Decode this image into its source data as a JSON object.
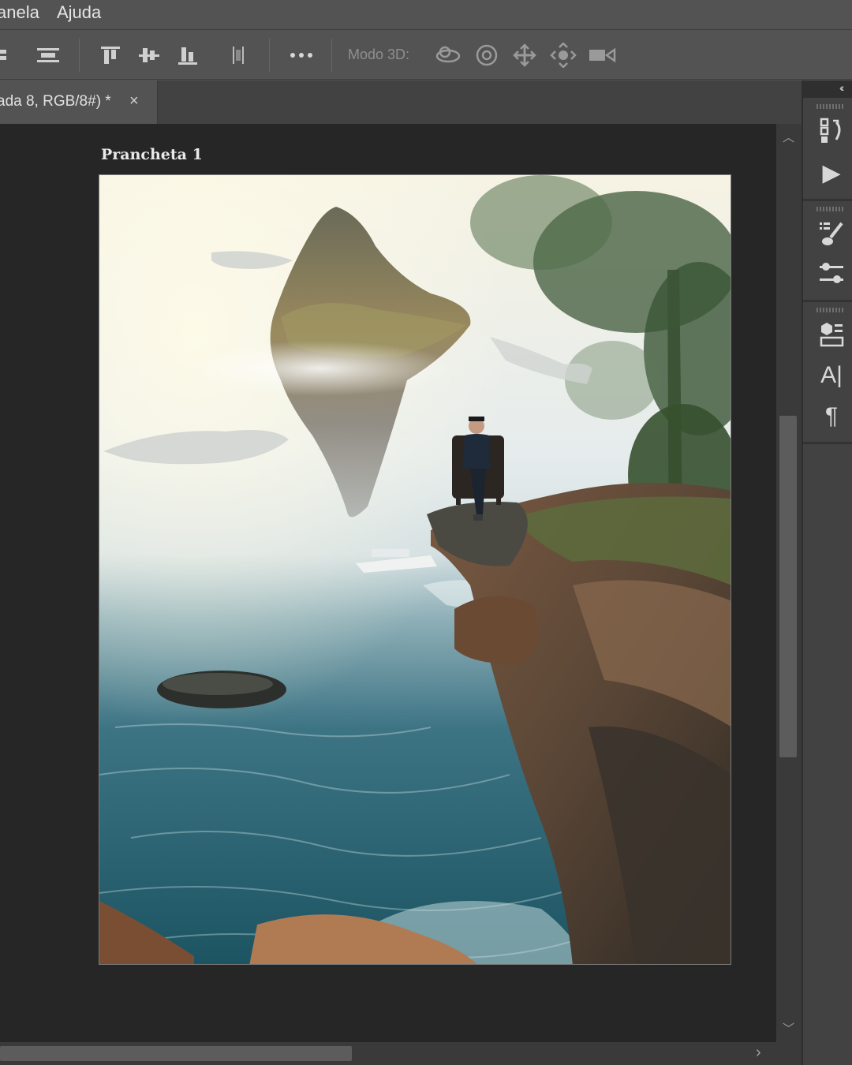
{
  "menu": {
    "items": [
      "anela",
      "Ajuda"
    ]
  },
  "options_bar": {
    "mode3d_label": "Modo 3D:",
    "icons": [
      "align-left-edge-icon",
      "align-center-horizontal-icon",
      "align-top-edge-icon",
      "align-vertical-center-icon",
      "align-bottom-edge-icon",
      "distribute-icon",
      "more-options-icon",
      "orbit-3d-icon",
      "roll-3d-icon",
      "pan-3d-icon",
      "slide-3d-icon",
      "scale-3d-icon"
    ]
  },
  "tab": {
    "title": "ada 8, RGB/8#) *",
    "close_glyph": "×"
  },
  "artboard": {
    "label": "Prancheta 1"
  },
  "scrollbars": {
    "up_glyph": "︿",
    "down_glyph": "﹀",
    "right_glyph": "›"
  },
  "dock": {
    "collapse_glyph": "‹‹",
    "icons": [
      "history-icon",
      "actions-play-icon",
      "brush-settings-icon",
      "adjustments-icon",
      "3d-layers-icon",
      "character-icon",
      "paragraph-icon"
    ],
    "character_glyph": "A|",
    "paragraph_glyph": "¶",
    "play_glyph": "▶"
  }
}
